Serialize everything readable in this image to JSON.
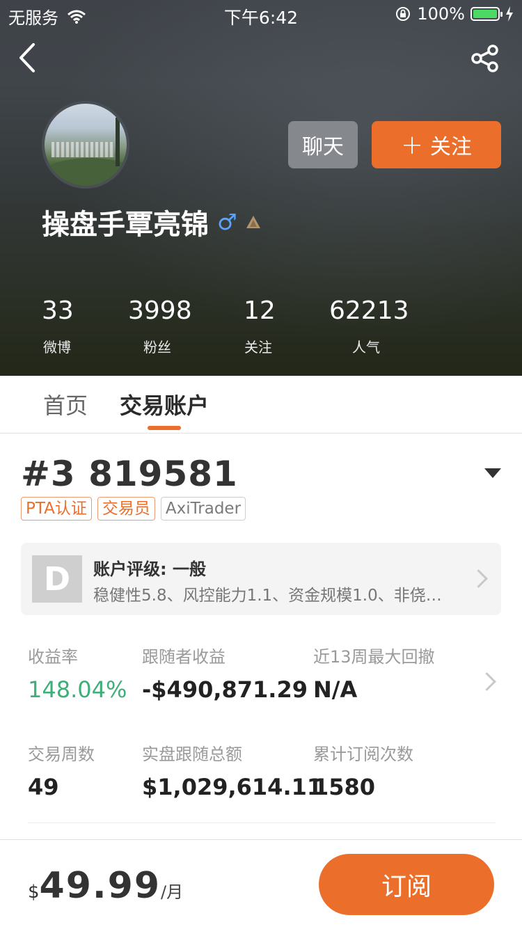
{
  "status_bar": {
    "carrier": "无服务",
    "time": "下午6:42",
    "battery_percent": "100%",
    "battery_level": 1.0,
    "battery_color": "#4cd964"
  },
  "header": {
    "back_icon": "chevron-left-icon",
    "share_icon": "share-icon"
  },
  "profile": {
    "username": "操盘手覃亮锦",
    "gender_symbol": "♂",
    "chat_label": "聊天",
    "follow_plus": "+",
    "follow_label": "关注",
    "stats": [
      {
        "value": "33",
        "label": "微博"
      },
      {
        "value": "3998",
        "label": "粉丝"
      },
      {
        "value": "12",
        "label": "关注"
      },
      {
        "value": "62213",
        "label": "人气"
      }
    ]
  },
  "tabs": [
    {
      "label": "首页",
      "active": false
    },
    {
      "label": "交易账户",
      "active": true
    }
  ],
  "account": {
    "title": "#3 819581",
    "tags": [
      "PTA认证",
      "交易员",
      "AxiTrader"
    ],
    "rating": {
      "grade": "D",
      "title": "账户评级: 一般",
      "description": "稳健性5.8、风控能力1.1、资金规模1.0、非侥…"
    },
    "metrics_row1": [
      {
        "label": "收益率",
        "value": "148.04%"
      },
      {
        "label": "跟随者收益",
        "value": "-$490,871.29"
      },
      {
        "label": "近13周最大回撤",
        "value": "N/A"
      }
    ],
    "metrics_row2": [
      {
        "label": "交易周数",
        "value": "49"
      },
      {
        "label": "实盘跟随总额",
        "value": "$1,029,614.11"
      },
      {
        "label": "累计订阅次数",
        "value": "1580"
      }
    ]
  },
  "footer": {
    "currency": "$",
    "price": "49.99",
    "unit": "/月",
    "subscribe_label": "订阅"
  },
  "colors": {
    "accent": "#ec6e2b",
    "positive": "#3fae78"
  }
}
